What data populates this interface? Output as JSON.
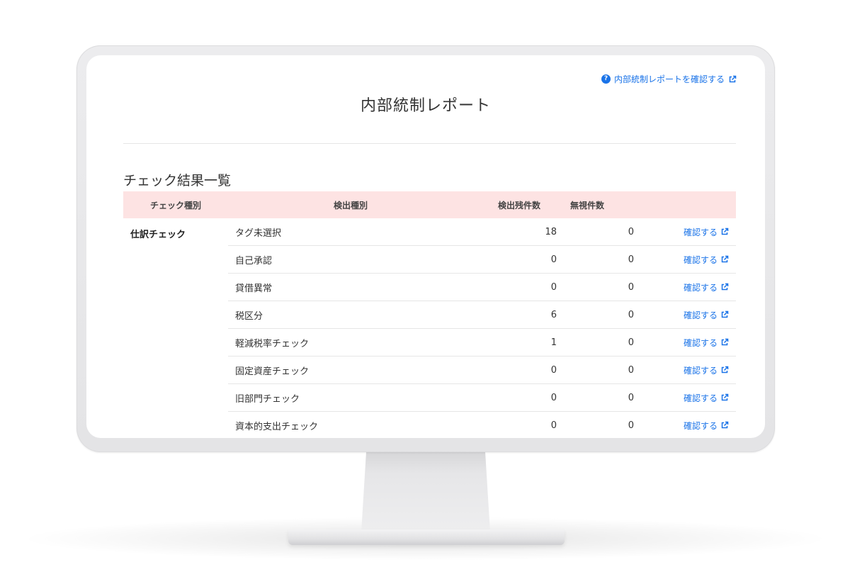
{
  "colors": {
    "accent": "#1a73e8",
    "table_header_bg": "#fde3e3",
    "divider": "#e6e6e6"
  },
  "header": {
    "help_link_label": "内部統制レポートを確認する",
    "help_icon": "question-circle-icon",
    "external_icon": "external-link-icon"
  },
  "page": {
    "title": "内部統制レポート"
  },
  "section": {
    "title": "チェック結果一覧"
  },
  "table": {
    "columns": {
      "check_type": "チェック種別",
      "detection_type": "検出種別",
      "remaining_count": "検出残件数",
      "ignored_count": "無視件数"
    },
    "group_label": "仕訳チェック",
    "action_label": "確認する",
    "rows": [
      {
        "name": "タグ未選択",
        "remaining": "18",
        "ignored": "0"
      },
      {
        "name": "自己承認",
        "remaining": "0",
        "ignored": "0"
      },
      {
        "name": "貸借異常",
        "remaining": "0",
        "ignored": "0"
      },
      {
        "name": "税区分",
        "remaining": "6",
        "ignored": "0"
      },
      {
        "name": "軽減税率チェック",
        "remaining": "1",
        "ignored": "0"
      },
      {
        "name": "固定資産チェック",
        "remaining": "0",
        "ignored": "0"
      },
      {
        "name": "旧部門チェック",
        "remaining": "0",
        "ignored": "0"
      },
      {
        "name": "資本的支出チェック",
        "remaining": "0",
        "ignored": "0"
      }
    ]
  }
}
